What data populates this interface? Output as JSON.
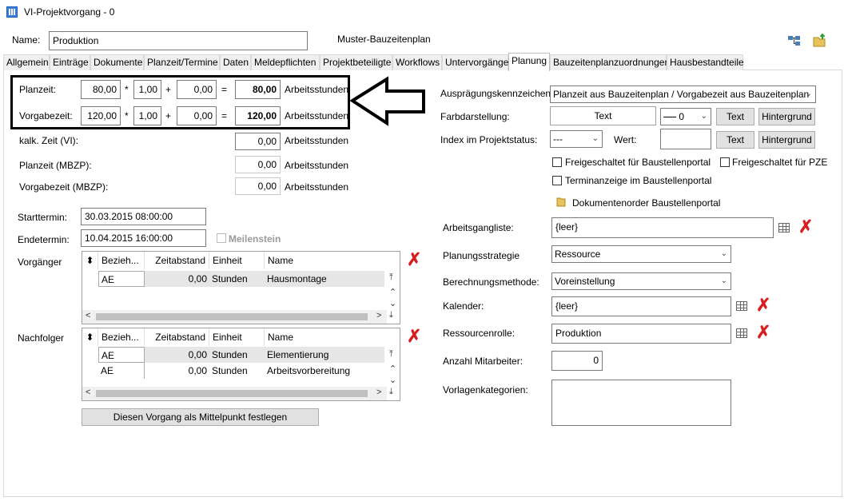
{
  "window": {
    "title": "VI-Projektvorgang - 0"
  },
  "header": {
    "name_label": "Name:",
    "name_value": "Produktion",
    "muster_label": "Muster-Bauzeitenplan"
  },
  "tabs": [
    {
      "label": "Allgemein"
    },
    {
      "label": "Einträge"
    },
    {
      "label": "Dokumente"
    },
    {
      "label": "Planzeit/Termine"
    },
    {
      "label": "Daten"
    },
    {
      "label": "Meldepflichten"
    },
    {
      "label": "Projektbeteiligte"
    },
    {
      "label": "Workflows"
    },
    {
      "label": "Untervorgänge"
    },
    {
      "label": "Planung"
    },
    {
      "label": "Bauzeitenplanzuordnungen"
    },
    {
      "label": "Hausbestandteile"
    }
  ],
  "active_tab": "Planung",
  "calc": {
    "planzeit": {
      "label": "Planzeit:",
      "a": "80,00",
      "op1": "*",
      "b": "1,00",
      "op2": "+",
      "c": "0,00",
      "eq": "=",
      "result": "80,00",
      "unit": "Arbeitsstunden"
    },
    "vorgabezeit": {
      "label": "Vorgabezeit:",
      "a": "120,00",
      "op1": "*",
      "b": "1,00",
      "op2": "+",
      "c": "0,00",
      "eq": "=",
      "result": "120,00",
      "unit": "Arbeitsstunden"
    }
  },
  "times": {
    "kalk": {
      "label": "kalk. Zeit (VI):",
      "value": "0,00",
      "unit": "Arbeitsstunden"
    },
    "plan_mbzp": {
      "label": "Planzeit (MBZP):",
      "value": "0,00",
      "unit": "Arbeitsstunden"
    },
    "vorgabe_mbzp": {
      "label": "Vorgabezeit (MBZP):",
      "value": "0,00",
      "unit": "Arbeitsstunden"
    }
  },
  "dates": {
    "start_label": "Starttermin:",
    "start_value": "30.03.2015 08:00:00",
    "end_label": "Endetermin:",
    "end_value": "10.04.2015 16:00:00",
    "milestone_label": "Meilenstein"
  },
  "grid_columns": {
    "bez": "Bezieh...",
    "abstand": "Zeitabstand",
    "einheit": "Einheit",
    "name": "Name"
  },
  "vorgaenger": {
    "label": "Vorgänger",
    "rows": [
      {
        "bez": "AE",
        "abstand": "0,00",
        "einheit": "Stunden",
        "name": "Hausmontage"
      }
    ]
  },
  "nachfolger": {
    "label": "Nachfolger",
    "rows": [
      {
        "bez": "AE",
        "abstand": "0,00",
        "einheit": "Stunden",
        "name": "Elementierung"
      },
      {
        "bez": "AE",
        "abstand": "0,00",
        "einheit": "Stunden",
        "name": "Arbeitsvorbereitung"
      }
    ]
  },
  "mittelpunkt_button": "Diesen Vorgang als Mittelpunkt festlegen",
  "right": {
    "auspraegung_label": "Ausprägungskennzeichen:",
    "auspraegung_value": "Planzeit aus Bauzeitenplan / Vorgabezeit aus Bauzeitenplan",
    "farb_label": "Farbdarstellung:",
    "farb_text": "Text",
    "line_value": "0",
    "text_button": "Text",
    "hintergrund_button": "Hintergrund",
    "index_label": "Index im Projektstatus:",
    "index_value": "---",
    "wert_label": "Wert:",
    "freigeschaltet_bp": "Freigeschaltet für Baustellenportal",
    "freigeschaltet_pze": "Freigeschaltet für PZE",
    "terminanzeige": "Terminanzeige im Baustellenportal",
    "dokumentenorder": "Dokumentenorder Baustellenportal",
    "arbeitsgang_label": "Arbeitsgangliste:",
    "arbeitsgang_value": "{leer}",
    "strategie_label": "Planungsstrategie",
    "strategie_value": "Ressource",
    "berechnung_label": "Berechnungsmethode:",
    "berechnung_value": "Voreinstellung",
    "kalender_label": "Kalender:",
    "kalender_value": "{leer}",
    "rolle_label": "Ressourcenrolle:",
    "rolle_value": "Produktion",
    "mitarbeiter_label": "Anzahl Mitarbeiter:",
    "mitarbeiter_value": "0",
    "vorlagen_label": "Vorlagenkategorien:"
  },
  "colors": {
    "highlight_box": "#000000",
    "delete": "#d81e1e",
    "active_tab_bg": "#ffffff"
  }
}
